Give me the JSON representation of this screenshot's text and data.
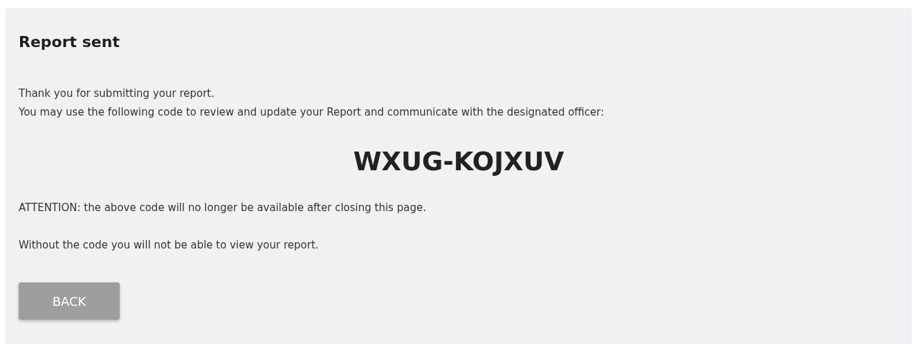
{
  "title": "Report sent",
  "intro": [
    "Thank you for submitting your report.",
    "You may use the following code to review and update your Report and communicate with the designated officer:"
  ],
  "code": "WXUG-KOJXUV",
  "notes": [
    "ATTENTION: the above code will no longer be available after closing this page.",
    "Without the code you will not be able to view your report."
  ],
  "back_button": "BACK"
}
